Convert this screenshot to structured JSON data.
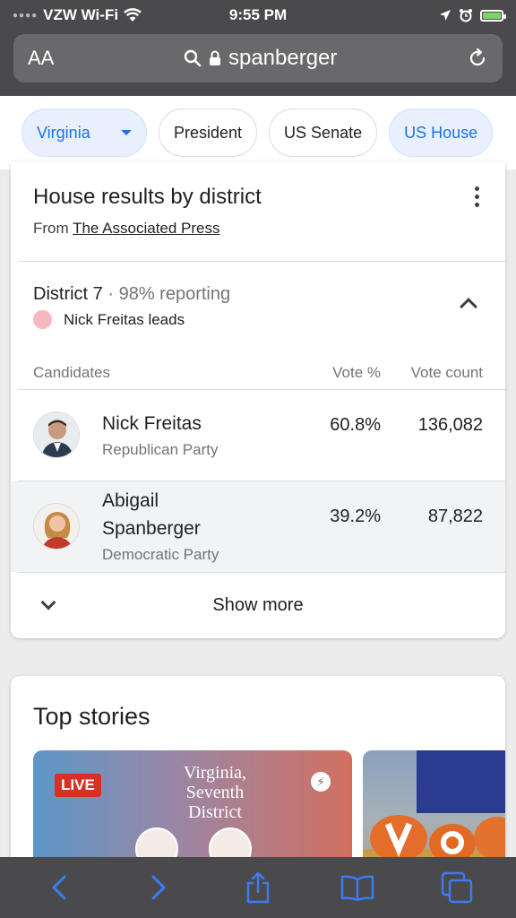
{
  "status_bar": {
    "carrier": "VZW Wi-Fi",
    "time": "9:55 PM"
  },
  "url_bar": {
    "text_size_label": "AA",
    "query": "spanberger"
  },
  "chips": [
    {
      "label": "Virginia",
      "active": true
    },
    {
      "label": "President",
      "active": false
    },
    {
      "label": "US Senate",
      "active": false
    },
    {
      "label": "US House",
      "active": true
    }
  ],
  "results": {
    "title": "House results by district",
    "source_prefix": "From",
    "source_name": "The Associated Press",
    "district": "District 7",
    "separator": "·",
    "reporting": "98% reporting",
    "leader_text": "Nick Freitas leads",
    "leader_color": "#f4b8be",
    "headers": {
      "candidates": "Candidates",
      "vote_pct": "Vote %",
      "vote_count": "Vote count"
    },
    "candidates": [
      {
        "name": "Nick Freitas",
        "party": "Republican Party",
        "vote_pct": "60.8%",
        "vote_count": "136,082"
      },
      {
        "name_line1": "Abigail",
        "name_line2": "Spanberger",
        "party": "Democratic Party",
        "vote_pct": "39.2%",
        "vote_count": "87,822"
      }
    ],
    "show_more": "Show more"
  },
  "top_stories": {
    "title": "Top stories",
    "story1": {
      "badge": "LIVE",
      "headline_line1": "Virginia,",
      "headline_line2": "Seventh",
      "headline_line3": "District"
    }
  },
  "toolbar": {
    "items": [
      "back-icon",
      "forward-icon",
      "share-icon",
      "bookmarks-icon",
      "tabs-icon"
    ]
  },
  "colors": {
    "accent": "#1a73e8",
    "chrome": "#4a4a4c",
    "live_badge": "#d93025"
  }
}
